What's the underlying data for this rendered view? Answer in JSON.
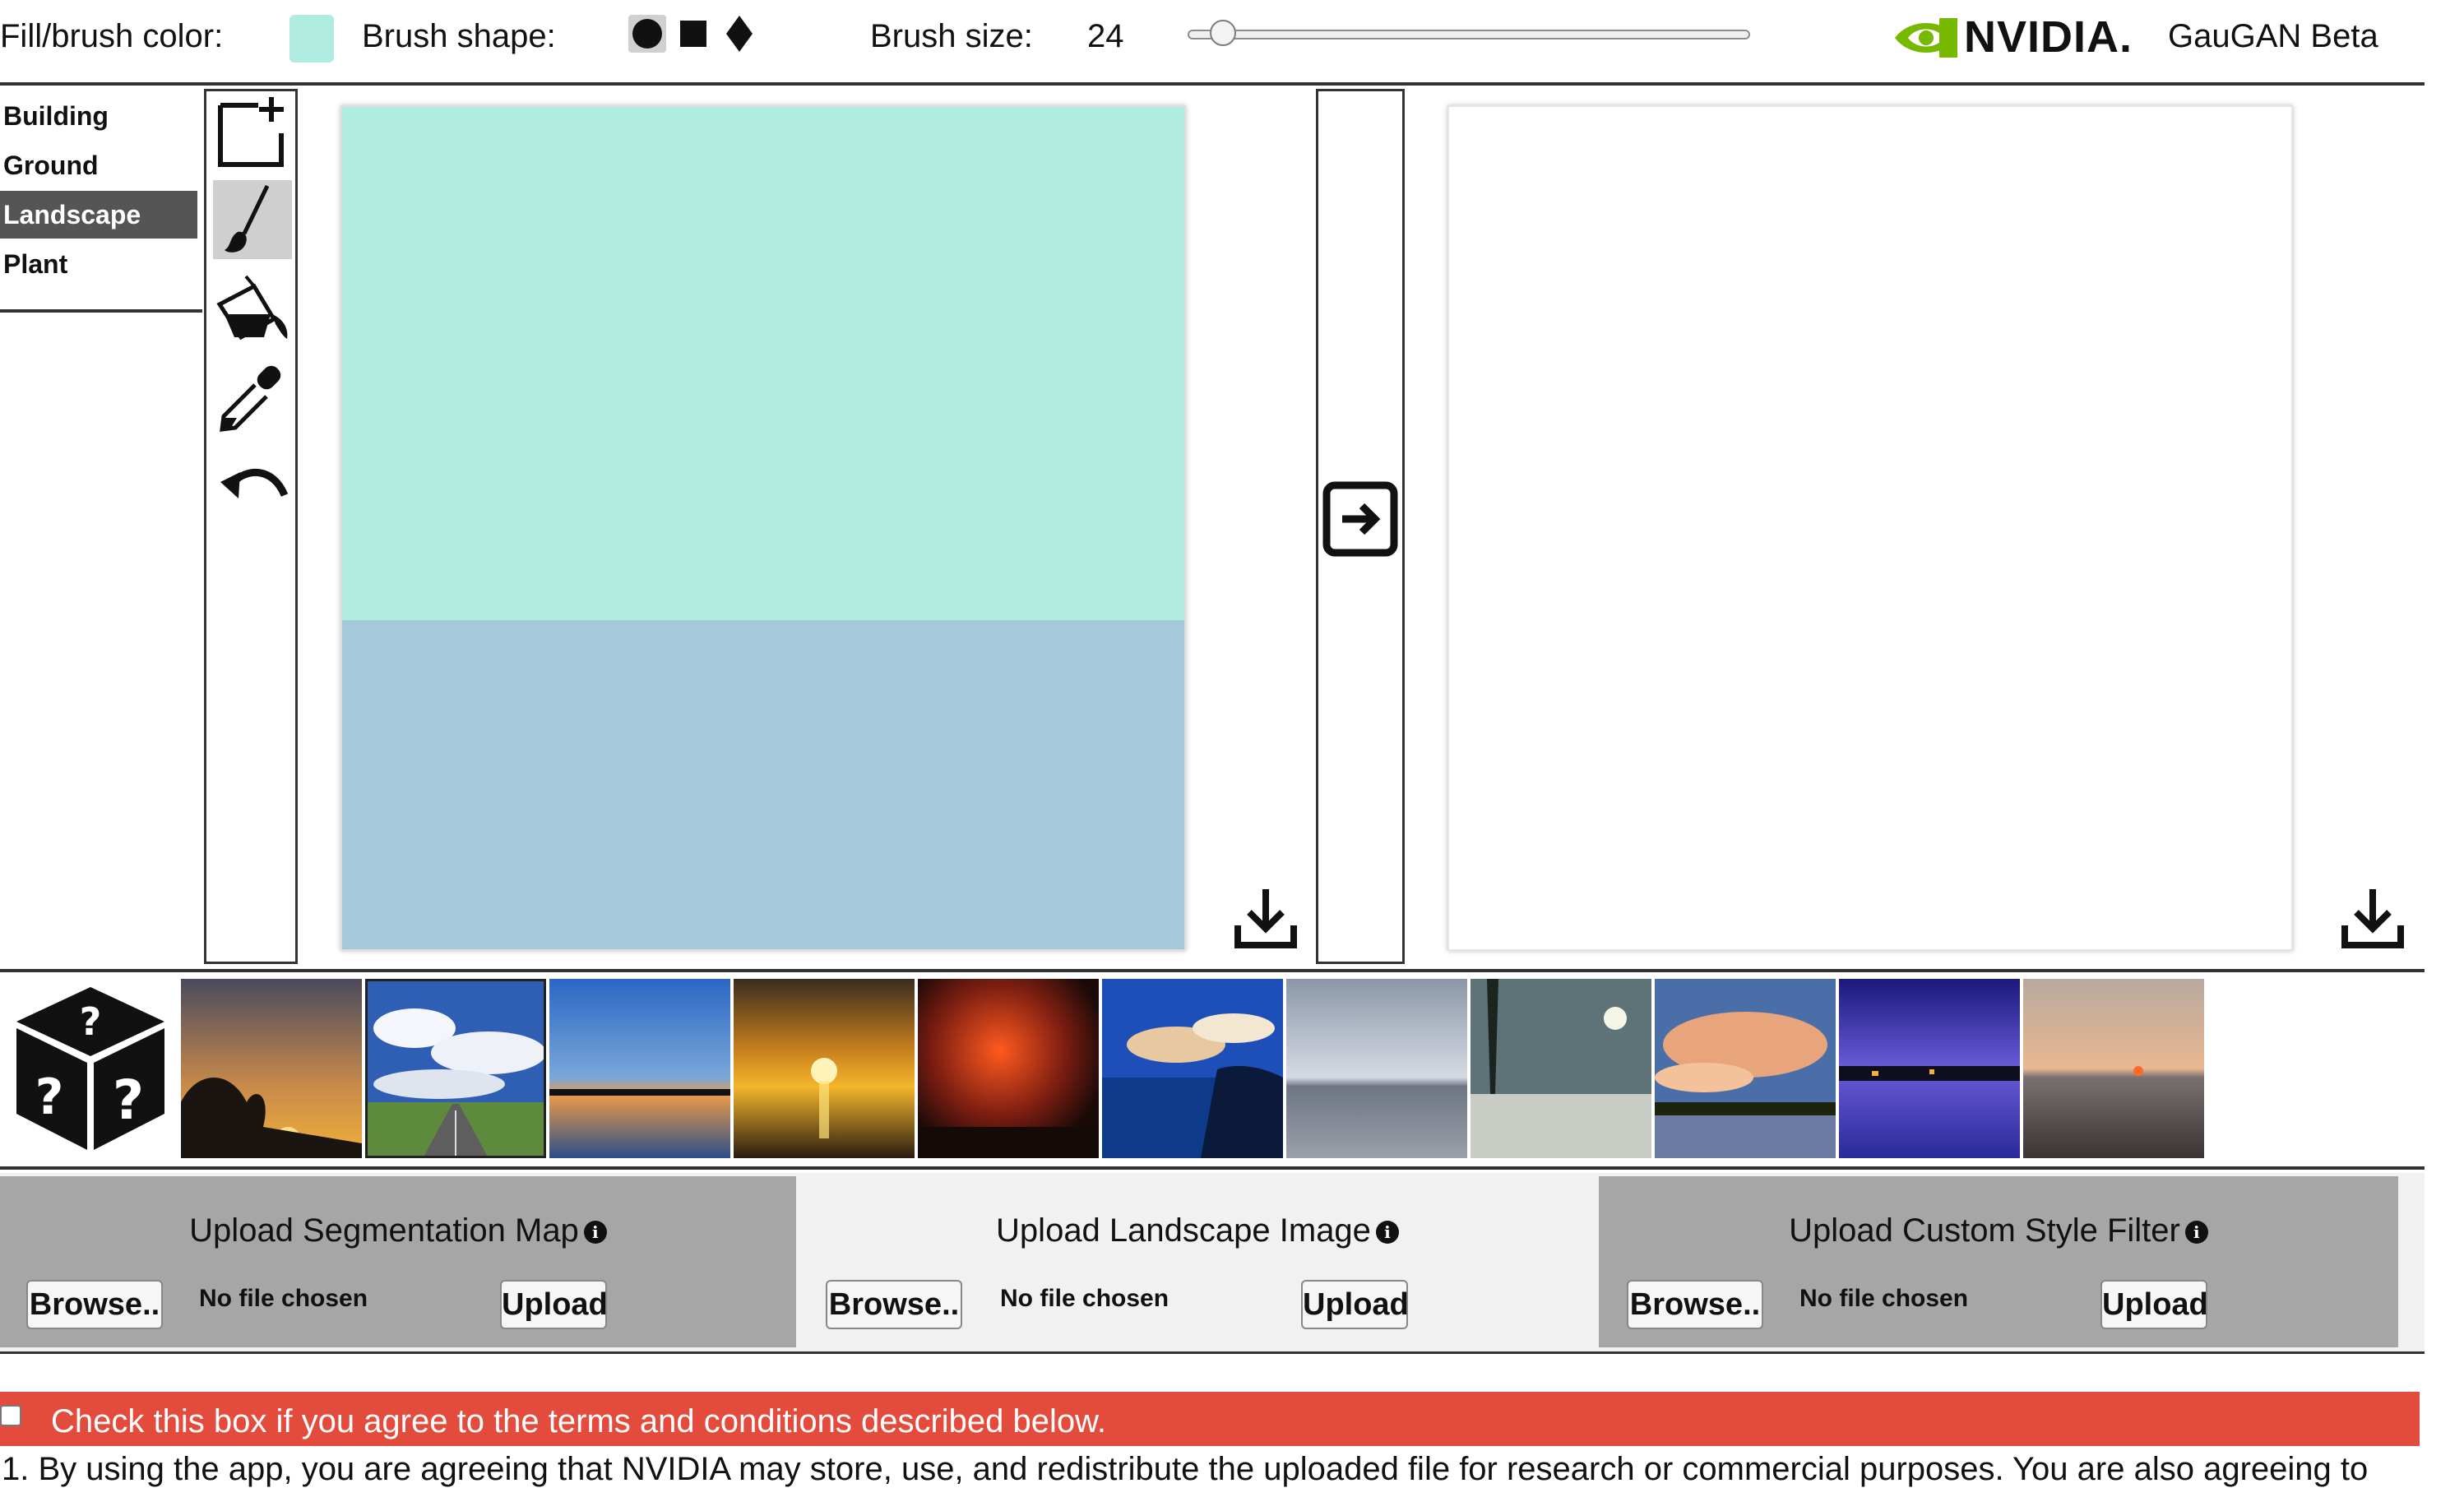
{
  "toolbar": {
    "fill_color_label": "Fill/brush color:",
    "fill_color": "#b0ece0",
    "brush_shape_label": "Brush shape:",
    "brush_shapes": [
      "circle",
      "square",
      "diamond"
    ],
    "selected_shape": "circle",
    "brush_size_label": "Brush size:",
    "brush_size": "24",
    "brush_size_fraction": 0.06
  },
  "brand": {
    "logo_text": "NVIDIA.",
    "app_title": "GauGAN Beta",
    "logo_color": "#76b900"
  },
  "labels": {
    "items": [
      "Building",
      "Ground",
      "Landscape",
      "Plant"
    ],
    "selected": "Landscape"
  },
  "tools": {
    "icons": [
      "new-canvas-icon",
      "brush-icon",
      "paint-bucket-icon",
      "eyedropper-icon",
      "undo-icon"
    ],
    "selected": "brush-icon"
  },
  "canvas": {
    "sky_color": "#b0ece0",
    "ground_color": "#a5c8db"
  },
  "uploads": {
    "segmentation": {
      "title": "Upload Segmentation Map",
      "browse": "Browse..",
      "status": "No file chosen",
      "upload": "Upload"
    },
    "landscape": {
      "title": "Upload Landscape Image",
      "browse": "Browse..",
      "status": "No file chosen",
      "upload": "Upload"
    },
    "style": {
      "title": "Upload Custom Style Filter",
      "browse": "Browse..",
      "status": "No file chosen",
      "upload": "Upload"
    }
  },
  "terms": {
    "checkbox_label": "Check this box if you agree to the terms and conditions described below.",
    "text": "1. By using the app, you are agreeing that NVIDIA may store, use, and redistribute the uploaded file for research or commercial purposes. You are also agreeing to"
  },
  "colors": {
    "accent_red": "#e34b3c",
    "panel_grey": "#a6a6a6"
  }
}
